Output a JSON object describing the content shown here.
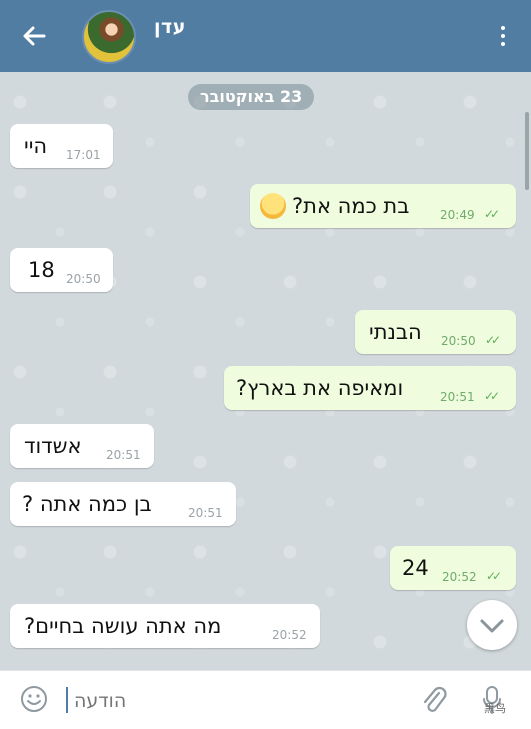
{
  "header": {
    "contact_name": "עדן"
  },
  "chat": {
    "date_label": "23 באוקטובר",
    "messages": [
      {
        "dir": "in",
        "text": "היי",
        "time": "17:01"
      },
      {
        "dir": "out",
        "text": "בת כמה את?",
        "time": "20:49",
        "emoji": "hugging-face-emoji"
      },
      {
        "dir": "in",
        "text": "18",
        "time": "20:50"
      },
      {
        "dir": "out",
        "text": "הבנתי",
        "time": "20:50"
      },
      {
        "dir": "out",
        "text": "ומאיפה את בארץ?",
        "time": "20:51"
      },
      {
        "dir": "in",
        "text": "אשדוד",
        "time": "20:51"
      },
      {
        "dir": "in",
        "text": "בן כמה אתה ?",
        "time": "20:51"
      },
      {
        "dir": "out",
        "text": "24",
        "time": "20:52"
      },
      {
        "dir": "in",
        "text": "מה אתה עושה בחיים?",
        "time": "20:52"
      }
    ]
  },
  "input": {
    "placeholder": "הודעה"
  },
  "colors": {
    "header": "#527da3",
    "outgoing_bubble": "#effdde",
    "incoming_bubble": "#ffffff",
    "read_ticks": "#5fae5a"
  },
  "watermark": "黑鸟"
}
